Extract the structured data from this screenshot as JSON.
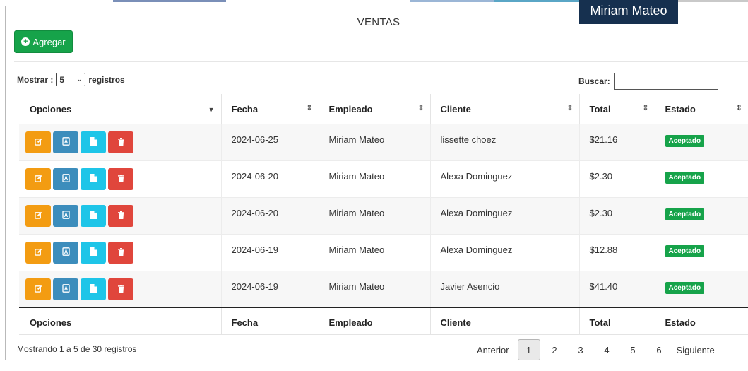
{
  "header": {
    "user_name": "Miriam Mateo",
    "title": "VENTAS"
  },
  "toolbar": {
    "add_label": "Agregar"
  },
  "length": {
    "prefix": "Mostrar :",
    "selected": "5",
    "suffix": "registros"
  },
  "search": {
    "label": "Buscar:",
    "value": ""
  },
  "table": {
    "columns": [
      "Opciones",
      "Fecha",
      "Empleado",
      "Cliente",
      "Total",
      "Estado"
    ],
    "rows": [
      {
        "fecha": "2024-06-25",
        "empleado": "Miriam Mateo",
        "cliente": "lissette choez",
        "total": "$21.16",
        "estado": "Aceptado"
      },
      {
        "fecha": "2024-06-20",
        "empleado": "Miriam Mateo",
        "cliente": "Alexa Dominguez",
        "total": "$2.30",
        "estado": "Aceptado"
      },
      {
        "fecha": "2024-06-20",
        "empleado": "Miriam Mateo",
        "cliente": "Alexa Dominguez",
        "total": "$2.30",
        "estado": "Aceptado"
      },
      {
        "fecha": "2024-06-19",
        "empleado": "Miriam Mateo",
        "cliente": "Alexa Dominguez",
        "total": "$12.88",
        "estado": "Aceptado"
      },
      {
        "fecha": "2024-06-19",
        "empleado": "Miriam Mateo",
        "cliente": "Javier Asencio",
        "total": "$41.40",
        "estado": "Aceptado"
      }
    ]
  },
  "footer": {
    "info": "Mostrando 1 a 5 de 30 registros"
  },
  "pagination": {
    "prev": "Anterior",
    "pages": [
      "1",
      "2",
      "3",
      "4",
      "5",
      "6"
    ],
    "next": "Siguiente"
  },
  "colors": {
    "accent_green": "#16a34a",
    "edit": "#f39c12",
    "pdf": "#3c8dbc",
    "doc": "#1ec5e8",
    "delete": "#e0463c",
    "header_badge": "#16304f"
  },
  "icons": {
    "add": "plus-circle-icon",
    "edit": "edit-icon",
    "pdf": "file-pdf-icon",
    "doc": "file-icon",
    "delete": "trash-icon"
  }
}
